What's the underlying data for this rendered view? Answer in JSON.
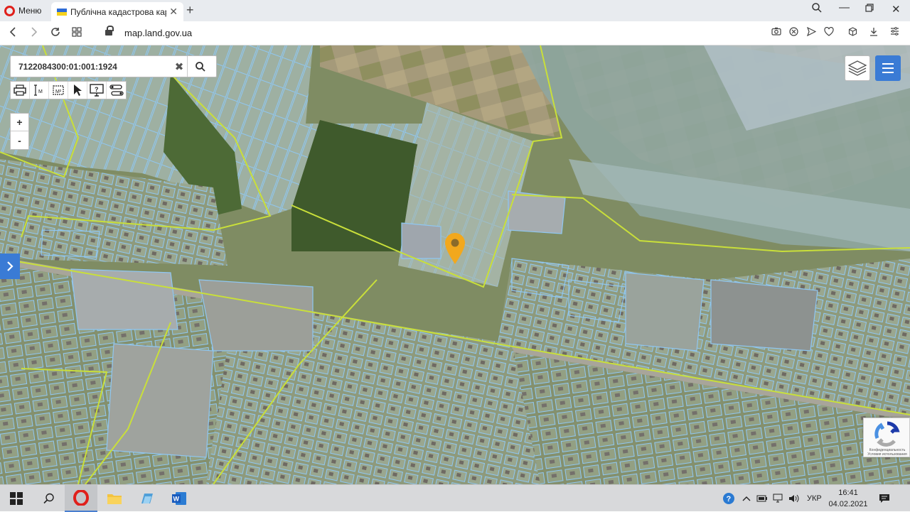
{
  "browser": {
    "menu_label": "Меню",
    "tab_title": "Публічна кадастрова карт",
    "url_host": "map.land.gov.ua"
  },
  "map": {
    "search_value": "7122084300:01:001:1924",
    "zoom_in": "+",
    "zoom_out": "-",
    "recaptcha_text_line1": "Конфиденциальность",
    "recaptcha_text_line2": "Условия использования",
    "colors": {
      "parcel_outline": "#8fc7f2",
      "boundary_line": "#c9df3a",
      "marker": "#f2a81d",
      "accent": "#3a7bd5"
    }
  },
  "taskbar": {
    "language": "УКР",
    "time": "16:41",
    "date": "04.02.2021"
  }
}
